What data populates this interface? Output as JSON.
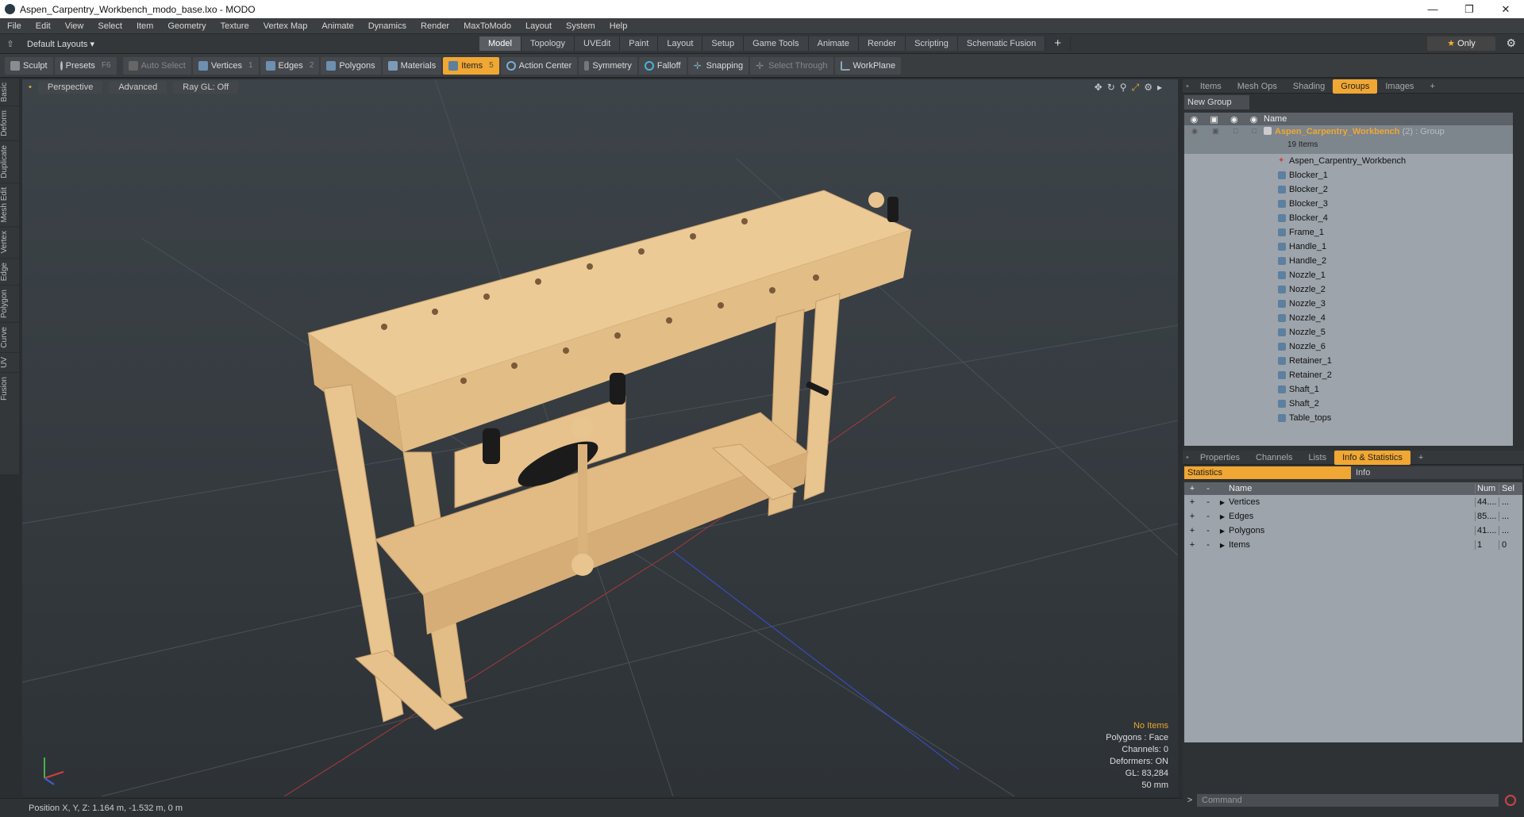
{
  "window": {
    "title": "Aspen_Carpentry_Workbench_modo_base.lxo - MODO"
  },
  "menu": [
    "File",
    "Edit",
    "View",
    "Select",
    "Item",
    "Geometry",
    "Texture",
    "Vertex Map",
    "Animate",
    "Dynamics",
    "Render",
    "MaxToModo",
    "Layout",
    "System",
    "Help"
  ],
  "layout_label": "Default Layouts ▾",
  "mode_tabs": [
    "Model",
    "Topology",
    "UVEdit",
    "Paint",
    "Layout",
    "Setup",
    "Game Tools",
    "Animate",
    "Render",
    "Scripting",
    "Schematic Fusion"
  ],
  "active_mode": "Model",
  "only_label": "Only",
  "toolbar": {
    "sculpt": "Sculpt",
    "presets": "Presets",
    "presets_key": "F6",
    "auto_select": "Auto Select",
    "vertices": "Vertices",
    "vertices_key": "1",
    "edges": "Edges",
    "edges_key": "2",
    "polygons": "Polygons",
    "materials": "Materials",
    "items": "Items",
    "items_key": "5",
    "action_center": "Action Center",
    "symmetry": "Symmetry",
    "falloff": "Falloff",
    "snapping": "Snapping",
    "select_through": "Select Through",
    "workplane": "WorkPlane"
  },
  "left_tabs": [
    "Basic",
    "Deform",
    "Duplicate",
    "Mesh Edit",
    "Vertex",
    "Edge",
    "Polygon",
    "Curve",
    "UV",
    "Fusion"
  ],
  "viewport": {
    "view": "Perspective",
    "shading": "Advanced",
    "raygl": "Ray GL: Off",
    "stats": {
      "selection": "No Items",
      "polygons": "Polygons : Face",
      "channels": "Channels: 0",
      "deformers": "Deformers: ON",
      "gl": "GL: 83,284",
      "size": "50 mm"
    }
  },
  "status": {
    "position": "Position X, Y, Z:  1.164 m, -1.532 m, 0 m"
  },
  "panel_tabs": [
    "Items",
    "Mesh Ops",
    "Shading",
    "Groups",
    "Images"
  ],
  "active_panel_tab": "Groups",
  "groups": {
    "new_group": "New Group",
    "name_header": "Name",
    "group_name": "Aspen_Carpentry_Workbench",
    "group_suffix": "(2) : Group",
    "group_count": "19 Items",
    "items": [
      "Aspen_Carpentry_Workbench",
      "Blocker_1",
      "Blocker_2",
      "Blocker_3",
      "Blocker_4",
      "Frame_1",
      "Handle_1",
      "Handle_2",
      "Nozzle_1",
      "Nozzle_2",
      "Nozzle_3",
      "Nozzle_4",
      "Nozzle_5",
      "Nozzle_6",
      "Retainer_1",
      "Retainer_2",
      "Shaft_1",
      "Shaft_2",
      "Table_tops"
    ]
  },
  "bottom_tabs": [
    "Properties",
    "Channels",
    "Lists",
    "Info & Statistics"
  ],
  "active_bottom_tab": "Info & Statistics",
  "stats_panel": {
    "tab_statistics": "Statistics",
    "tab_info": "Info",
    "headers": {
      "name": "Name",
      "num": "Num",
      "sel": "Sel"
    },
    "rows": [
      {
        "name": "Vertices",
        "num": "44....",
        "sel": "..."
      },
      {
        "name": "Edges",
        "num": "85....",
        "sel": "..."
      },
      {
        "name": "Polygons",
        "num": "41....",
        "sel": "..."
      },
      {
        "name": "Items",
        "num": "1",
        "sel": "0"
      }
    ]
  },
  "command_placeholder": "Command",
  "colors": {
    "accent": "#f0a733",
    "wood": "#e8c48f"
  }
}
